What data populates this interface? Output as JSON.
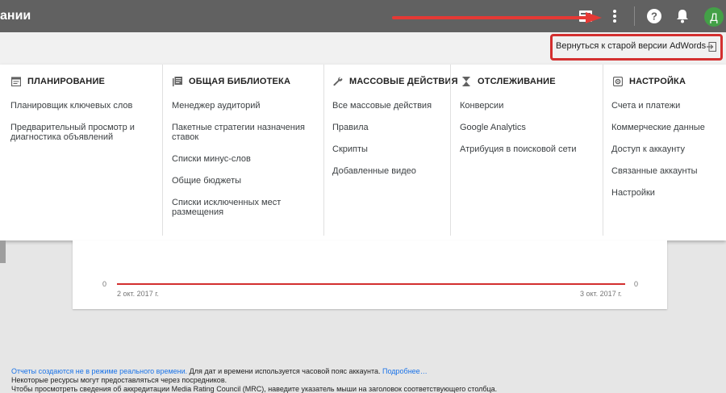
{
  "header": {
    "title_fragment": "ании",
    "avatar_letter": "Д"
  },
  "old_version": {
    "label": "Вернуться к старой версии AdWords"
  },
  "menu": {
    "columns": [
      {
        "title": "ПЛАНИРОВАНИЕ",
        "icon": "calendar-icon",
        "items": [
          "Планировщик ключевых слов",
          "Предварительный просмотр и",
          "диагностика объявлений"
        ]
      },
      {
        "title": "ОБЩАЯ БИБЛИОТЕКА",
        "icon": "library-icon",
        "items": [
          "Менеджер аудиторий",
          "Пакетные стратегии назначения",
          "ставок",
          "Списки минус-слов",
          "Общие бюджеты",
          "Списки исключенных мест",
          "размещения"
        ]
      },
      {
        "title": "МАССОВЫЕ ДЕЙСТВИЯ",
        "icon": "wrench-icon",
        "items": [
          "Все массовые действия",
          "Правила",
          "Скрипты",
          "Добавленные видео"
        ]
      },
      {
        "title": "ОТСЛЕЖИВАНИЕ",
        "icon": "hourglass-icon",
        "items": [
          "Конверсии",
          "Google Analytics",
          "Атрибуция в поисковой сети"
        ]
      },
      {
        "title": "НАСТРОЙКА",
        "icon": "settings-icon",
        "items": [
          "Счета и платежи",
          "Коммерческие данные",
          "Доступ к аккаунту",
          "Связанные аккаунты",
          "Настройки"
        ]
      }
    ]
  },
  "chart": {
    "left_zero": "0",
    "right_zero": "0",
    "start_date": "2 окт. 2017 г.",
    "end_date": "3 окт. 2017 г."
  },
  "chart_data": {
    "type": "line",
    "x": [
      "2 окт. 2017 г.",
      "3 окт. 2017 г."
    ],
    "series": [
      {
        "values": [
          0,
          0
        ]
      }
    ],
    "title": "",
    "xlabel": "",
    "ylabel": ""
  },
  "footer": {
    "line1_link": "Отчеты создаются не в режиме реального времени.",
    "line1_text": " Для дат и времени используется часовой пояс аккаунта. ",
    "line1_more": "Подробнее…",
    "line2": "Некоторые ресурсы могут предоставляться через посредников.",
    "line3": "Чтобы просмотреть сведения об аккредитации Media Rating Council (MRC), наведите указатель мыши на заголовок соответствующего столбца."
  },
  "colors": {
    "topbar": "#616161",
    "highlight_red": "#d32f2f",
    "avatar_green": "#43a047",
    "link_blue": "#1a73e8"
  }
}
